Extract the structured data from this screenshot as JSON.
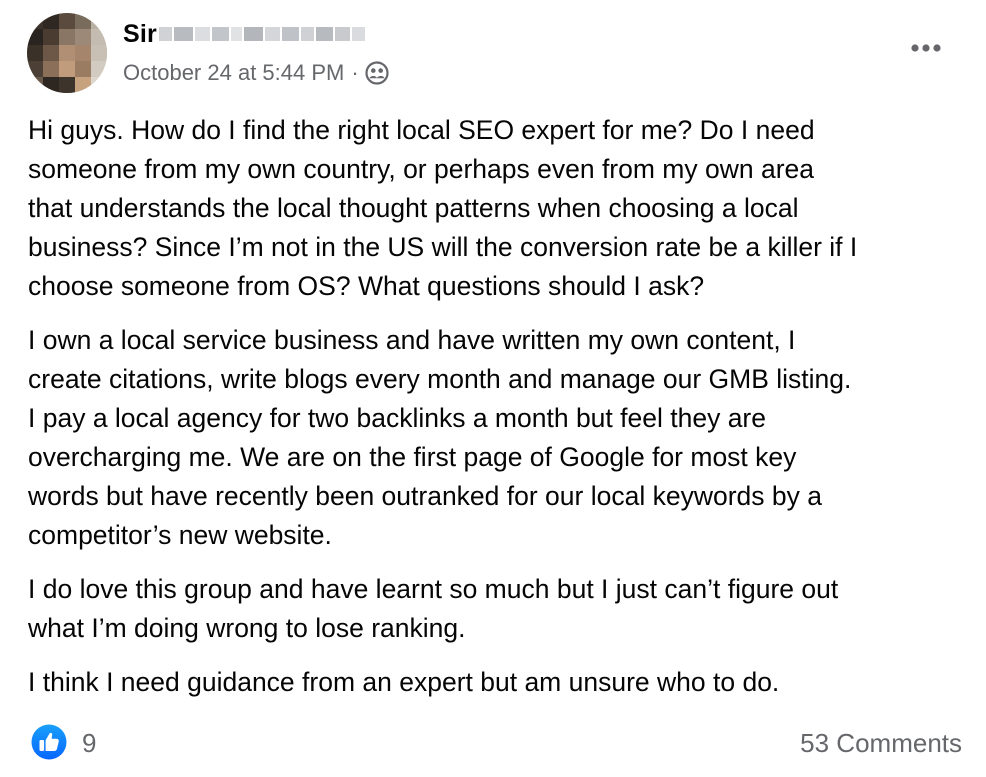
{
  "post": {
    "author": {
      "name_visible": "Sir",
      "name_redacted": true
    },
    "timestamp": "October 24 at 5:44 PM",
    "separator": "·",
    "audience_icon": "friends-icon",
    "more_icon": "more-options-icon",
    "paragraphs": [
      "Hi guys. How do I find the right local SEO expert for me? Do I need\nsomeone from my own country, or perhaps even from my own area\nthat understands the local thought patterns when choosing a local\nbusiness? Since I’m not in the US will the conversion rate be a killer if I\nchoose someone from OS? What questions should I ask?",
      "I own a local service business and have written my own content, I\ncreate citations, write blogs every month and manage our GMB listing.\nI pay a local agency for two backlinks a month but feel they are\novercharging me. We are on the first page of Google for most key\nwords but have recently been outranked for our local keywords by a\ncompetitor’s new website.",
      "I do love this group and have learnt so much but I just can’t figure out\nwhat I’m doing wrong to lose ranking.",
      "I think I need guidance from an expert but am unsure who to do."
    ],
    "reactions": {
      "icon": "like-icon",
      "count": "9"
    },
    "comments_label": "53 Comments"
  },
  "colors": {
    "text_primary": "#050505",
    "text_secondary": "#65676b",
    "like_blue": "#1877f2",
    "background": "#ffffff"
  }
}
